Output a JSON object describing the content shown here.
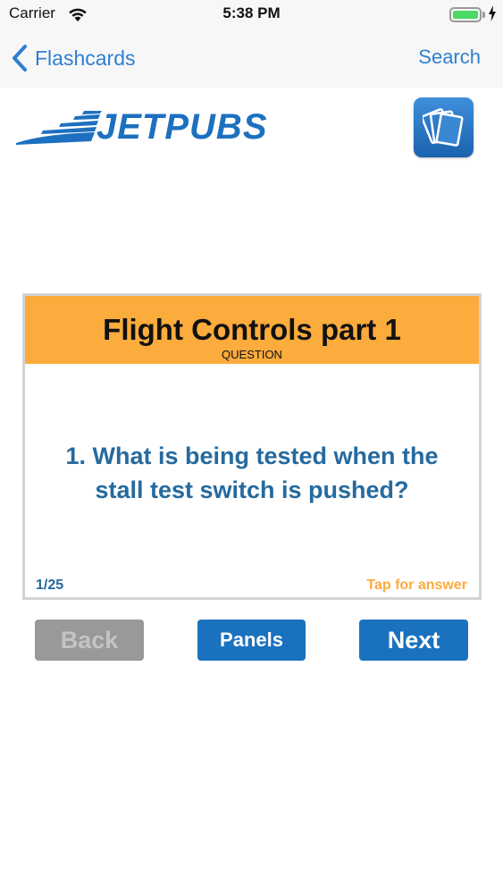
{
  "status_bar": {
    "carrier": "Carrier",
    "time": "5:38 PM",
    "battery_level": 1.0,
    "charging": true
  },
  "nav": {
    "back_label": "Flashcards",
    "search_label": "Search"
  },
  "logo": {
    "text": "JETPUBS"
  },
  "card": {
    "title": "Flight Controls part 1",
    "subtitle": "QUESTION",
    "question": "1. What is being tested when the stall test switch is pushed?",
    "counter": "1/25",
    "tap_hint": "Tap for answer"
  },
  "buttons": {
    "back": "Back",
    "panels": "Panels",
    "next": "Next"
  },
  "colors": {
    "accent": "#1a72bf",
    "header_orange": "#fcab3d",
    "question_text": "#266a9e",
    "disabled": "#999999"
  }
}
